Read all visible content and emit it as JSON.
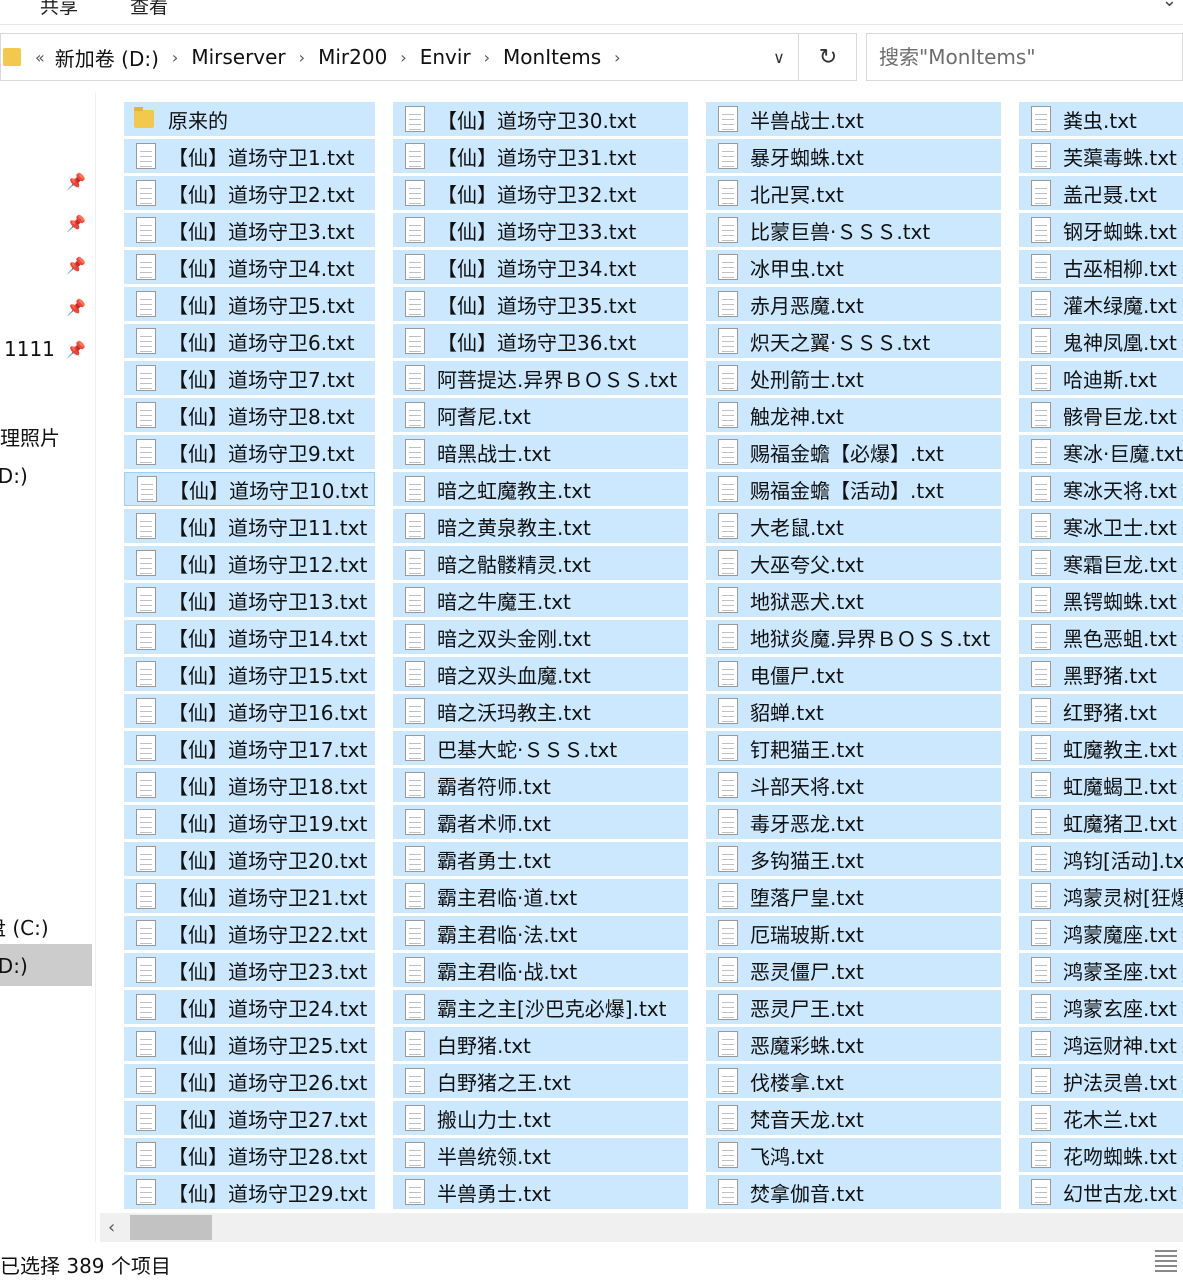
{
  "ribbon": {
    "tab_share": "共享",
    "tab_view": "查看"
  },
  "address": {
    "back_chevrons": "«",
    "crumbs": [
      "新加卷 (D:)",
      "Mirserver",
      "Mir200",
      "Envir",
      "MonItems"
    ],
    "dropdown_glyph": "∨",
    "refresh_glyph": "↻"
  },
  "search": {
    "placeholder": "搜索\"MonItems\""
  },
  "nav": {
    "item_1111": "1111",
    "item_photos": "处理照片",
    "item_d_top": "(D:)",
    "item_c": "盘 (C:)",
    "item_d_bottom": "(D:)"
  },
  "columns": [
    [
      "原来的",
      "【仙】道场守卫1.txt",
      "【仙】道场守卫2.txt",
      "【仙】道场守卫3.txt",
      "【仙】道场守卫4.txt",
      "【仙】道场守卫5.txt",
      "【仙】道场守卫6.txt",
      "【仙】道场守卫7.txt",
      "【仙】道场守卫8.txt",
      "【仙】道场守卫9.txt",
      "【仙】道场守卫10.txt",
      "【仙】道场守卫11.txt",
      "【仙】道场守卫12.txt",
      "【仙】道场守卫13.txt",
      "【仙】道场守卫14.txt",
      "【仙】道场守卫15.txt",
      "【仙】道场守卫16.txt",
      "【仙】道场守卫17.txt",
      "【仙】道场守卫18.txt",
      "【仙】道场守卫19.txt",
      "【仙】道场守卫20.txt",
      "【仙】道场守卫21.txt",
      "【仙】道场守卫22.txt",
      "【仙】道场守卫23.txt",
      "【仙】道场守卫24.txt",
      "【仙】道场守卫25.txt",
      "【仙】道场守卫26.txt",
      "【仙】道场守卫27.txt",
      "【仙】道场守卫28.txt",
      "【仙】道场守卫29.txt"
    ],
    [
      "【仙】道场守卫30.txt",
      "【仙】道场守卫31.txt",
      "【仙】道场守卫32.txt",
      "【仙】道场守卫33.txt",
      "【仙】道场守卫34.txt",
      "【仙】道场守卫35.txt",
      "【仙】道场守卫36.txt",
      "阿菩提达.异界ＢＯＳＳ.txt",
      "阿耆尼.txt",
      "暗黑战士.txt",
      "暗之虹魔教主.txt",
      "暗之黄泉教主.txt",
      "暗之骷髅精灵.txt",
      "暗之牛魔王.txt",
      "暗之双头金刚.txt",
      "暗之双头血魔.txt",
      "暗之沃玛教主.txt",
      "巴基大蛇·ＳＳＳ.txt",
      "霸者符师.txt",
      "霸者术师.txt",
      "霸者勇士.txt",
      "霸主君临·道.txt",
      "霸主君临·法.txt",
      "霸主君临·战.txt",
      "霸主之主[沙巴克必爆].txt",
      "白野猪.txt",
      "白野猪之王.txt",
      "搬山力士.txt",
      "半兽统领.txt",
      "半兽勇士.txt"
    ],
    [
      "半兽战士.txt",
      "暴牙蜘蛛.txt",
      "北卍冥.txt",
      "比蒙巨兽·ＳＳＳ.txt",
      "冰甲虫.txt",
      "赤月恶魔.txt",
      "炽天之翼·ＳＳＳ.txt",
      "处刑箭士.txt",
      "触龙神.txt",
      "赐福金蟾【必爆】.txt",
      "赐福金蟾【活动】.txt",
      "大老鼠.txt",
      "大巫夸父.txt",
      "地狱恶犬.txt",
      "地狱炎魔.异界ＢＯＳＳ.txt",
      "电僵尸.txt",
      "貂蝉.txt",
      "钉耙猫王.txt",
      "斗部天将.txt",
      "毒牙恶龙.txt",
      "多钩猫王.txt",
      "堕落尸皇.txt",
      "厄瑞玻斯.txt",
      "恶灵僵尸.txt",
      "恶灵尸王.txt",
      "恶魔彩蛛.txt",
      "伐楼拿.txt",
      "梵音天龙.txt",
      "飞鸿.txt",
      "焚拿伽音.txt"
    ],
    [
      "粪虫.txt",
      "芙蕖毒蛛.txt",
      "盖卍聂.txt",
      "钢牙蜘蛛.txt",
      "古巫相柳.txt",
      "灌木绿魔.txt",
      "鬼神凤凰.txt",
      "哈迪斯.txt",
      "骸骨巨龙.txt",
      "寒冰·巨魔.txt",
      "寒冰天将.txt",
      "寒冰卫士.txt",
      "寒霜巨龙.txt",
      "黑锷蜘蛛.txt",
      "黑色恶蛆.txt",
      "黑野猪.txt",
      "红野猪.txt",
      "虹魔教主.txt",
      "虹魔蝎卫.txt",
      "虹魔猪卫.txt",
      "鸿钧[活动].txt",
      "鸿蒙灵树[狂爆]",
      "鸿蒙魔座.txt",
      "鸿蒙圣座.txt",
      "鸿蒙玄座.txt",
      "鸿运财神.txt",
      "护法灵兽.txt",
      "花木兰.txt",
      "花吻蜘蛛.txt",
      "幻世古龙.txt"
    ]
  ],
  "status": {
    "text": "已选择 389 个项目"
  }
}
